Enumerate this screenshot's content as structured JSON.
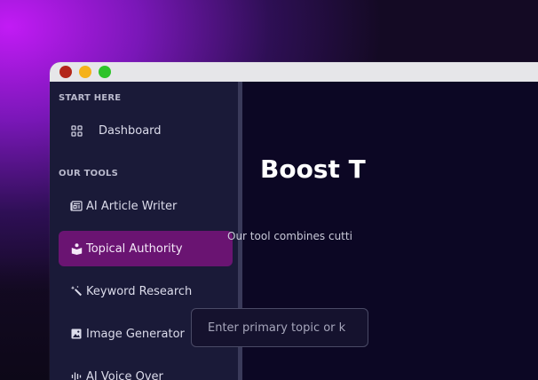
{
  "window": {
    "controls": [
      "close",
      "minimize",
      "maximize"
    ]
  },
  "sidebar": {
    "section_start": "START HERE",
    "dashboard": {
      "label": "Dashboard",
      "icon": "grid-icon"
    },
    "section_tools": "OUR TOOLS",
    "tools": [
      {
        "label": "AI Article Writer",
        "icon": "newspaper-icon",
        "active": false
      },
      {
        "label": "Topical Authority",
        "icon": "book-reader-icon",
        "active": true
      },
      {
        "label": "Keyword Research",
        "icon": "magic-wand-icon",
        "active": false
      },
      {
        "label": "Image Generator",
        "icon": "image-icon",
        "active": false
      },
      {
        "label": "AI Voice Over",
        "icon": "waveform-icon",
        "active": false
      }
    ]
  },
  "main": {
    "title": "Boost T",
    "subtitle": "Our tool combines cutti",
    "input_placeholder": "Enter primary topic or k"
  },
  "colors": {
    "sidebar_bg": "#1a1a38",
    "main_bg": "#0c0724",
    "active_item": "#6a1472",
    "accent_gradient": "#c21bf5"
  }
}
